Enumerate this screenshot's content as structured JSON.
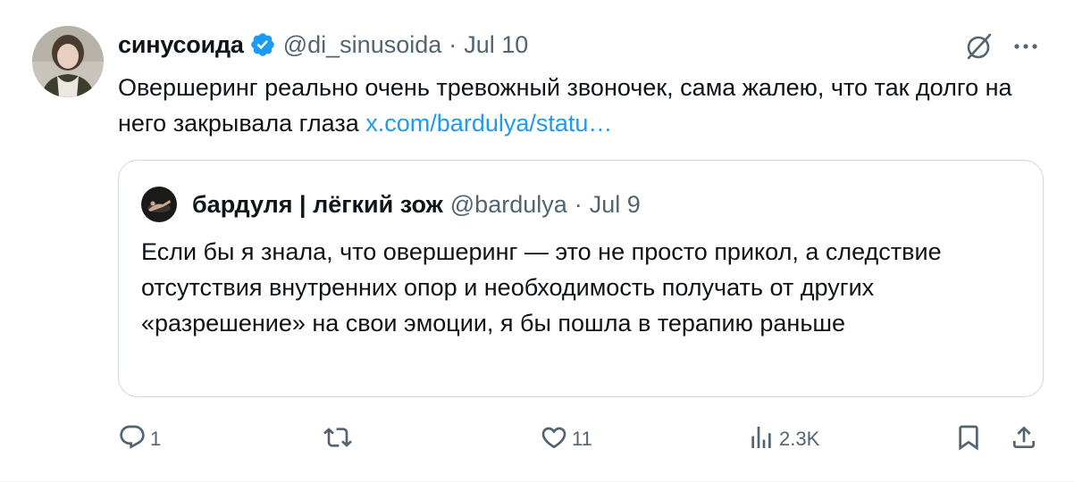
{
  "author": {
    "display_name": "синусоида",
    "handle": "@di_sinusoida",
    "separator": "·",
    "date": "Jul 10"
  },
  "tweet": {
    "text": "Овершеринг реально очень тревожный звоночек, сама жалею, что так долго на него закрывала глаза ",
    "link_text": "x.com/bardulya/statu…"
  },
  "quote": {
    "display_name": "бардуля | лёгкий зож",
    "handle": "@bardulya",
    "separator": "·",
    "date": "Jul 9",
    "text": "Если бы я знала, что овершеринг — это не просто прикол, а следствие отсутствия внутренних опор и необходимость получать от других «разрешение» на свои эмоции, я бы пошла в терапию раньше"
  },
  "actions": {
    "replies": "1",
    "retweets": "",
    "likes": "11",
    "views": "2.3K"
  },
  "icons": {
    "verified": "verified-badge-icon",
    "grok": "grok-icon",
    "more": "more-icon",
    "reply": "reply-icon",
    "retweet": "retweet-icon",
    "like": "heart-icon",
    "views": "views-icon",
    "bookmark": "bookmark-icon",
    "share": "share-icon"
  },
  "colors": {
    "verified_blue": "#1d9bf0",
    "link_blue": "#1d9bf0",
    "secondary_text": "#536471",
    "primary_text": "#0f1419",
    "border": "#cfd9de"
  }
}
